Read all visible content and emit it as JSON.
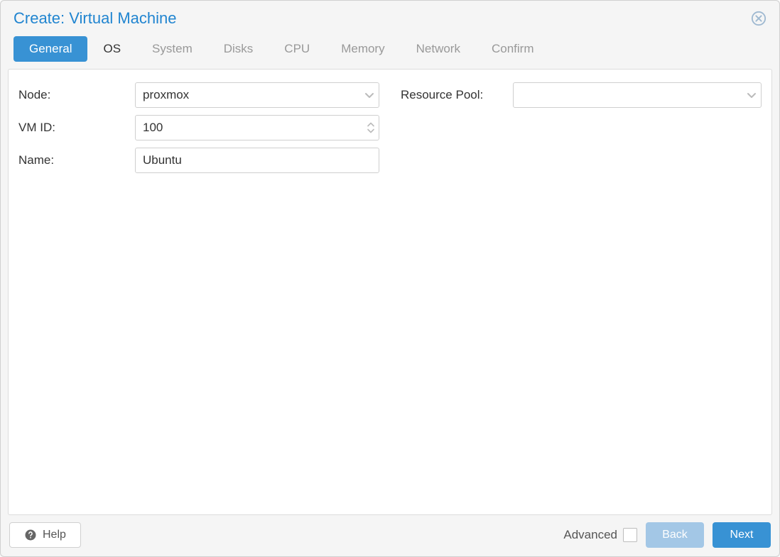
{
  "title": "Create: Virtual Machine",
  "tabs": [
    {
      "label": "General",
      "state": "active"
    },
    {
      "label": "OS",
      "state": "enabled"
    },
    {
      "label": "System",
      "state": "disabled"
    },
    {
      "label": "Disks",
      "state": "disabled"
    },
    {
      "label": "CPU",
      "state": "disabled"
    },
    {
      "label": "Memory",
      "state": "disabled"
    },
    {
      "label": "Network",
      "state": "disabled"
    },
    {
      "label": "Confirm",
      "state": "disabled"
    }
  ],
  "form": {
    "node": {
      "label": "Node:",
      "value": "proxmox"
    },
    "vmid": {
      "label": "VM ID:",
      "value": "100"
    },
    "name": {
      "label": "Name:",
      "value": "Ubuntu"
    },
    "pool": {
      "label": "Resource Pool:",
      "value": ""
    }
  },
  "footer": {
    "help": "Help",
    "advanced": "Advanced",
    "advanced_checked": false,
    "back": "Back",
    "next": "Next"
  }
}
